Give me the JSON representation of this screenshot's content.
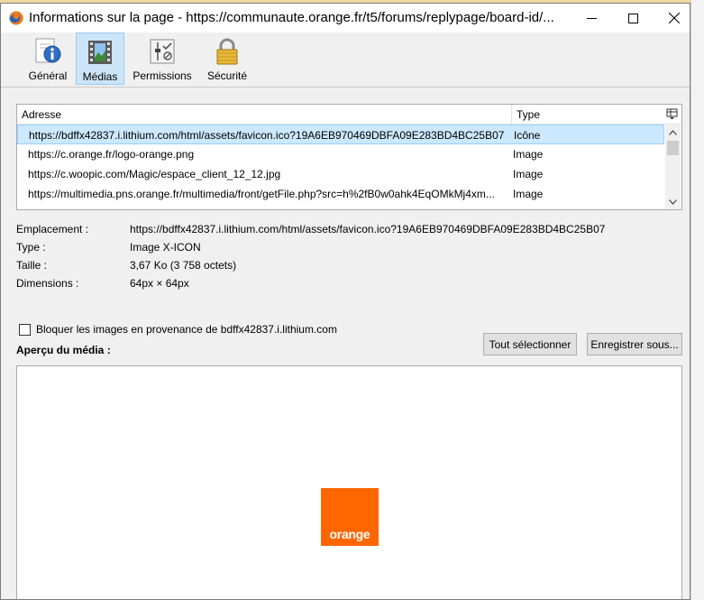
{
  "window": {
    "title": "Informations sur la page - https://communaute.orange.fr/t5/forums/replypage/board-id/..."
  },
  "toolbar": {
    "items": [
      {
        "label": "Général",
        "icon": "info-icon",
        "selected": false
      },
      {
        "label": "Médias",
        "icon": "media-icon",
        "selected": true
      },
      {
        "label": "Permissions",
        "icon": "permissions-icon",
        "selected": false
      },
      {
        "label": "Sécurité",
        "icon": "lock-icon",
        "selected": false
      }
    ]
  },
  "media_list": {
    "columns": [
      "Adresse",
      "Type"
    ],
    "rows": [
      {
        "address": "https://bdffx42837.i.lithium.com/html/assets/favicon.ico?19A6EB970469DBFA09E283BD4BC25B07",
        "type": "Icône"
      },
      {
        "address": "https://c.orange.fr/logo-orange.png",
        "type": "Image"
      },
      {
        "address": "https://c.woopic.com/Magic/espace_client_12_12.jpg",
        "type": "Image"
      },
      {
        "address": "https://multimedia.pns.orange.fr/multimedia/front/getFile.php?src=h%2fB0w0ahk4EqOMkMj4xm...",
        "type": "Image"
      }
    ]
  },
  "properties": [
    {
      "key": "Emplacement :",
      "value": "https://bdffx42837.i.lithium.com/html/assets/favicon.ico?19A6EB970469DBFA09E283BD4BC25B07"
    },
    {
      "key": "Type :",
      "value": "Image X-ICON"
    },
    {
      "key": "Taille :",
      "value": "3,67 Ko (3 758 octets)"
    },
    {
      "key": "Dimensions :",
      "value": "64px × 64px"
    }
  ],
  "block_label": "Bloquer les images en provenance de bdffx42837.i.lithium.com",
  "preview_label": "Aperçu du média :",
  "buttons": {
    "select_all": "Tout sélectionner",
    "save_as": "Enregistrer sous..."
  },
  "preview": {
    "logo_text": "orange",
    "logo_color": "#ff6600"
  },
  "colors": {
    "selection": "#cce8ff",
    "toolbar_selected": "#cce4f7"
  }
}
